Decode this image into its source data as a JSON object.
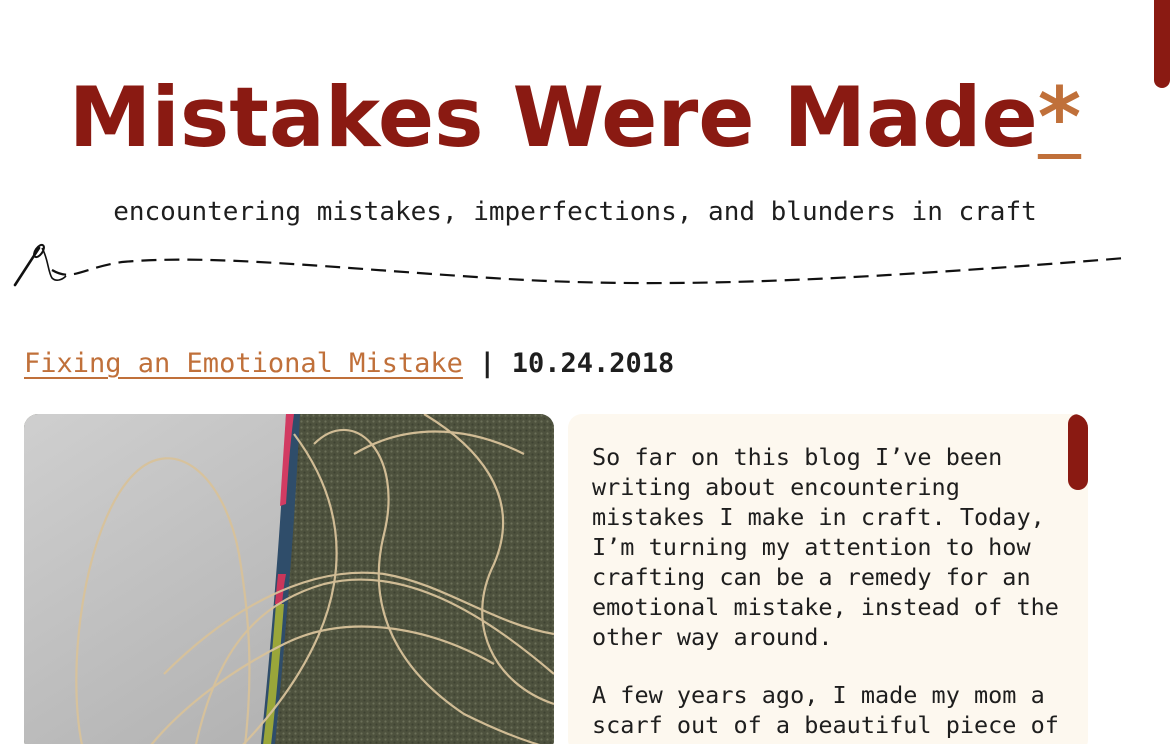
{
  "site": {
    "title_main": "Mistakes Were Made",
    "title_asterisk": "*",
    "tagline": "encountering mistakes, imperfections, and blunders in craft"
  },
  "post": {
    "title": "Fixing an Emotional Mistake",
    "separator": "|",
    "date": "10.24.2018",
    "paragraphs": [
      "So far on this blog I’ve been writing about encountering mistakes I make in craft. Today, I’m turning my attention to how crafting can be a remedy for an emotional mistake, instead of the other way around.",
      "A few years ago, I made my mom a scarf out of a beautiful piece of"
    ]
  },
  "colors": {
    "brand_red": "#8a1a12",
    "accent_orange": "#c0703a",
    "panel_bg": "#fdf8ef"
  },
  "icons": {
    "divider": "needle-and-thread-icon"
  }
}
